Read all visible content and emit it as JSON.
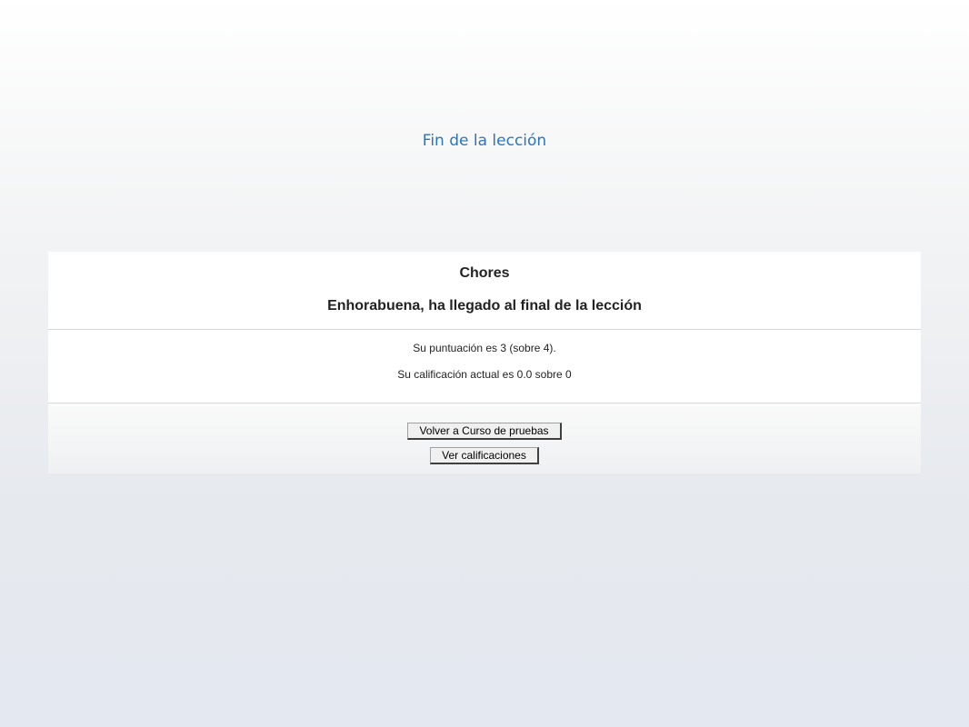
{
  "slide": {
    "title": "Fin de la lección"
  },
  "lesson": {
    "course_name": "Chores",
    "congrats": "Enhorabuena, ha llegado al final de la lección",
    "score_text": "Su puntuación es 3 (sobre 4).",
    "grade_text": "Su calificación actual es 0.0 sobre 0"
  },
  "actions": {
    "back_label": "Volver a Curso de pruebas",
    "grades_label": "Ver calificaciones"
  },
  "colors": {
    "title": "#2e75b6",
    "panel_background": "#ffffff"
  }
}
